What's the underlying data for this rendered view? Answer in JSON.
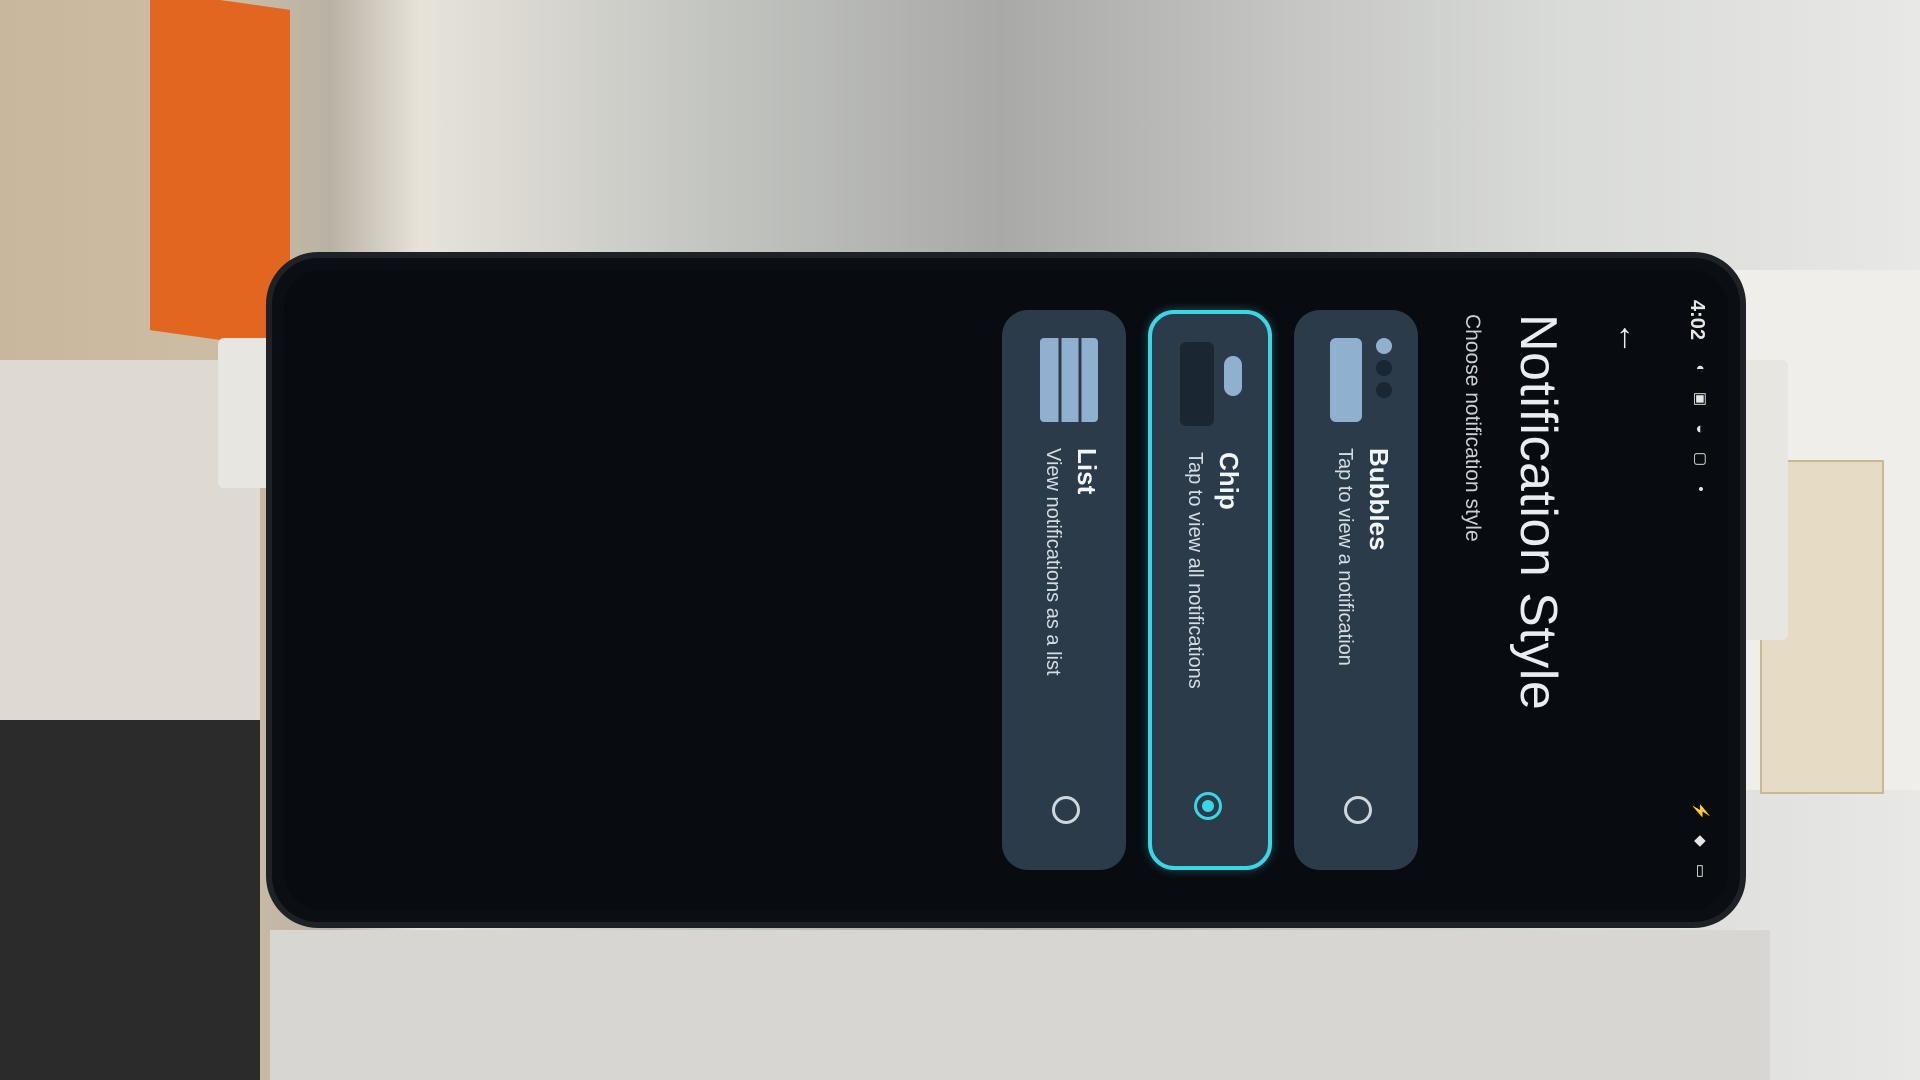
{
  "status_bar": {
    "time": "4:02"
  },
  "header": {
    "title": "Notification Style",
    "subtitle": "Choose notification style"
  },
  "options": [
    {
      "title": "Bubbles",
      "description": "Tap to view a notification",
      "selected": false
    },
    {
      "title": "Chip",
      "description": "Tap to view all notifications",
      "selected": true
    },
    {
      "title": "List",
      "description": "View notifications as a list",
      "selected": false
    }
  ],
  "colors": {
    "accent": "#39d6e6",
    "card": "#2b3b4a",
    "thumb": "#8fb1cf",
    "background": "#080b10"
  },
  "icons": {
    "back": "arrow-back-icon",
    "nav_back": "triangle-back-icon",
    "nav_home": "circle-home-icon",
    "nav_recents": "square-recents-icon"
  }
}
